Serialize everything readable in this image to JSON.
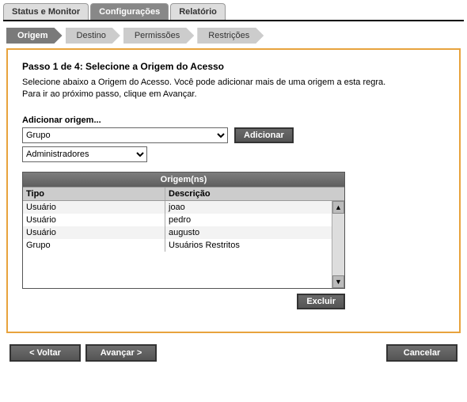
{
  "topTabs": {
    "status": "Status e Monitor",
    "config": "Configurações",
    "report": "Relatório"
  },
  "steps": {
    "origem": "Origem",
    "destino": "Destino",
    "permissoes": "Permissões",
    "restricoes": "Restrições"
  },
  "panel": {
    "title": "Passo 1 de 4: Selecione a Origem do Acesso",
    "desc1": "Selecione abaixo a Origem do Acesso. Você pode adicionar mais de uma origem a esta regra.",
    "desc2": "Para ir ao próximo passo, clique em Avançar.",
    "addLabel": "Adicionar origem...",
    "typeSelected": "Grupo",
    "subSelected": "Administradores",
    "addButton": "Adicionar",
    "tableTitle": "Origem(ns)",
    "colTipo": "Tipo",
    "colDesc": "Descrição",
    "rows": [
      {
        "tipo": "Usuário",
        "desc": "joao"
      },
      {
        "tipo": "Usuário",
        "desc": "pedro"
      },
      {
        "tipo": "Usuário",
        "desc": "augusto"
      },
      {
        "tipo": "Grupo",
        "desc": "Usuários Restritos"
      }
    ],
    "deleteButton": "Excluir"
  },
  "nav": {
    "back": "< Voltar",
    "next": "Avançar >",
    "cancel": "Cancelar"
  }
}
